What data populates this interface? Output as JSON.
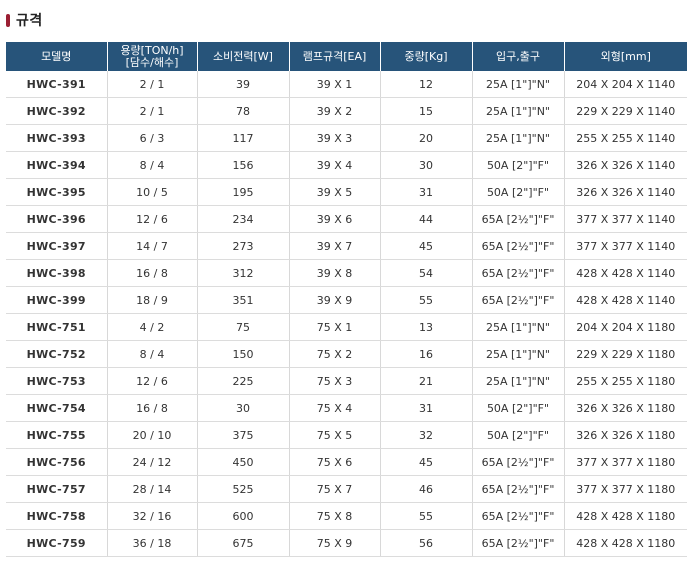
{
  "section_title": "규격",
  "table": {
    "headers": [
      "모델명",
      "용량[TON/h]\n[담수/해수]",
      "소비전력[W]",
      "램프규격[EA]",
      "중량[Kg]",
      "입구,출구",
      "외형[mm]"
    ],
    "rows": [
      [
        "HWC-391",
        "2 / 1",
        "39",
        "39 X 1",
        "12",
        "25A [1\"]\"N\"",
        "204 X 204 X 1140"
      ],
      [
        "HWC-392",
        "2 / 1",
        "78",
        "39 X 2",
        "15",
        "25A [1\"]\"N\"",
        "229 X 229 X 1140"
      ],
      [
        "HWC-393",
        "6 / 3",
        "117",
        "39 X 3",
        "20",
        "25A [1\"]\"N\"",
        "255 X 255 X 1140"
      ],
      [
        "HWC-394",
        "8 / 4",
        "156",
        "39 X 4",
        "30",
        "50A [2\"]\"F\"",
        "326 X 326 X 1140"
      ],
      [
        "HWC-395",
        "10 / 5",
        "195",
        "39 X 5",
        "31",
        "50A [2\"]\"F\"",
        "326 X 326 X 1140"
      ],
      [
        "HWC-396",
        "12 / 6",
        "234",
        "39 X 6",
        "44",
        "65A [2½\"]\"F\"",
        "377 X 377 X 1140"
      ],
      [
        "HWC-397",
        "14 / 7",
        "273",
        "39 X 7",
        "45",
        "65A [2½\"]\"F\"",
        "377 X 377 X 1140"
      ],
      [
        "HWC-398",
        "16 / 8",
        "312",
        "39 X 8",
        "54",
        "65A [2½\"]\"F\"",
        "428 X 428 X 1140"
      ],
      [
        "HWC-399",
        "18 / 9",
        "351",
        "39 X 9",
        "55",
        "65A [2½\"]\"F\"",
        "428 X 428 X 1140"
      ],
      [
        "HWC-751",
        "4 / 2",
        "75",
        "75 X 1",
        "13",
        "25A [1\"]\"N\"",
        "204 X 204 X 1180"
      ],
      [
        "HWC-752",
        "8 / 4",
        "150",
        "75 X 2",
        "16",
        "25A [1\"]\"N\"",
        "229 X 229 X 1180"
      ],
      [
        "HWC-753",
        "12 / 6",
        "225",
        "75 X 3",
        "21",
        "25A [1\"]\"N\"",
        "255 X 255 X 1180"
      ],
      [
        "HWC-754",
        "16 / 8",
        "30",
        "75 X 4",
        "31",
        "50A [2\"]\"F\"",
        "326 X 326 X 1180"
      ],
      [
        "HWC-755",
        "20 / 10",
        "375",
        "75 X 5",
        "32",
        "50A [2\"]\"F\"",
        "326 X 326 X 1180"
      ],
      [
        "HWC-756",
        "24 / 12",
        "450",
        "75 X 6",
        "45",
        "65A [2½\"]\"F\"",
        "377 X 377 X 1180"
      ],
      [
        "HWC-757",
        "28 / 14",
        "525",
        "75 X 7",
        "46",
        "65A [2½\"]\"F\"",
        "377 X 377 X 1180"
      ],
      [
        "HWC-758",
        "32 / 16",
        "600",
        "75 X 8",
        "55",
        "65A [2½\"]\"F\"",
        "428 X 428 X 1180"
      ],
      [
        "HWC-759",
        "36 / 18",
        "675",
        "75 X 9",
        "56",
        "65A [2½\"]\"F\"",
        "428 X 428 X 1180"
      ]
    ]
  },
  "colors": {
    "header_bg": "#27547a",
    "title_marker": "#9b1f33"
  }
}
